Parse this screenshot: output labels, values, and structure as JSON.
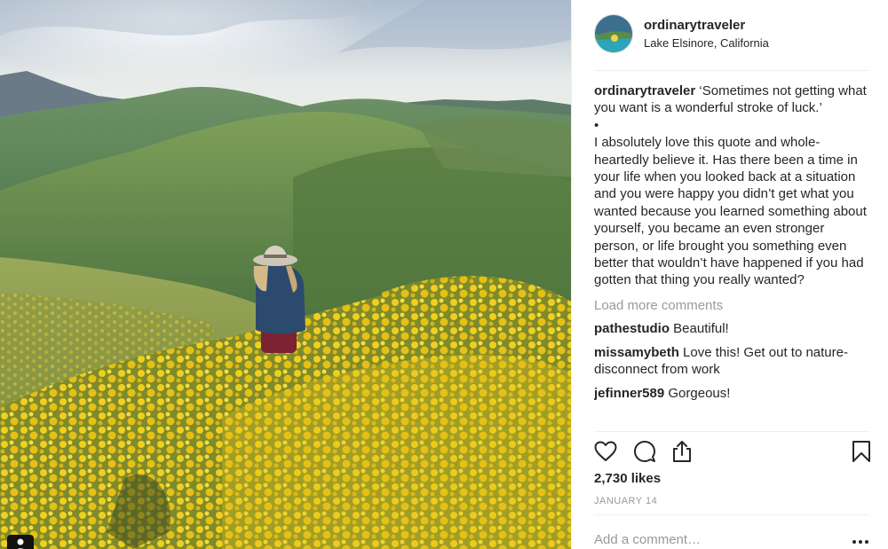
{
  "post": {
    "username": "ordinarytraveler",
    "location": "Lake Elsinore, California",
    "caption_text": "‘Sometimes not getting what you want is a wonderful stroke of luck.’\n•\nI absolutely love this quote and whole-heartedly believe it. Has there been a time in your life when you looked back at a situation and you were happy you didn’t get what you wanted because you learned something about yourself, you became an even stronger person, or life brought you something even better that wouldn’t have happened if you had gotten that thing you really wanted?",
    "load_more_label": "Load more comments",
    "comments": [
      {
        "user": "pathestudio",
        "text": "Beautiful!"
      },
      {
        "user": "missamybeth",
        "text": "Love this! Get out to nature- disconnect from work"
      },
      {
        "user": "jefinner589",
        "text": "Gorgeous!"
      }
    ],
    "likes": "2,730 likes",
    "date": "JANUARY 14",
    "add_comment_placeholder": "Add a comment…"
  },
  "icons": {
    "like": "heart-icon",
    "comment": "comment-bubble-icon",
    "share": "share-icon",
    "save": "bookmark-icon",
    "more": "more-options-icon",
    "tag": "user-tag-icon"
  },
  "colors": {
    "text": "#262626",
    "muted": "#999999",
    "divider": "#efefef",
    "flowers": "#e8c820"
  }
}
